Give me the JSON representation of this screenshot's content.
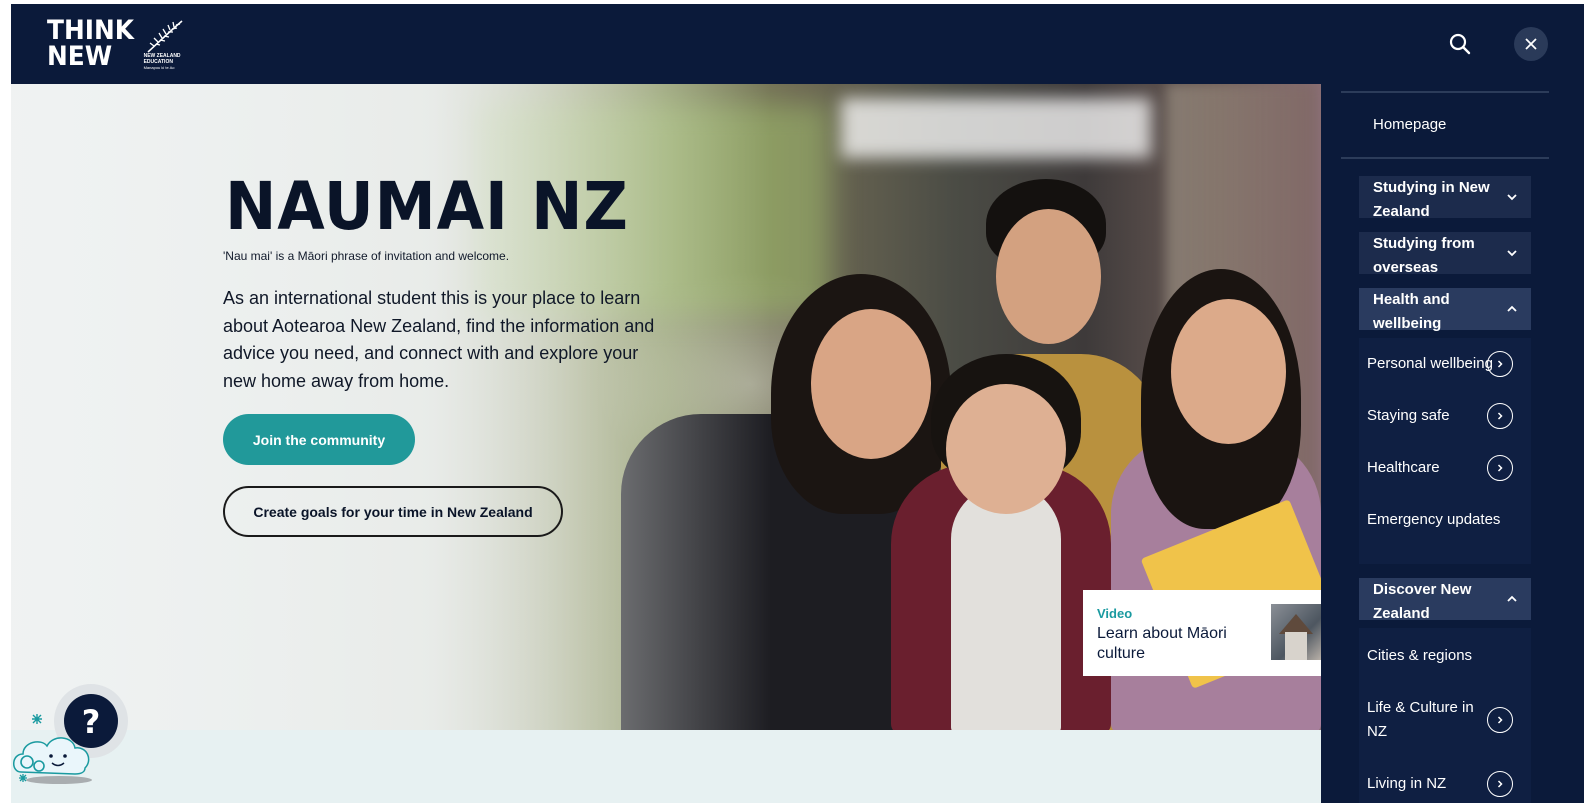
{
  "header": {
    "logo_line1": "THINK",
    "logo_line2": "NEW",
    "logo_sub1": "NEW ZEALAND",
    "logo_sub2": "EDUCATION",
    "logo_sub3": "Manapou ki te Ao"
  },
  "hero": {
    "title": "NAUMAI NZ",
    "subtitle": "'Nau mai' is a Māori phrase of invitation and welcome.",
    "lead": "As an international student this is your place to learn about Aotearoa New Zealand, find the information and advice you need, and connect with and explore your new home away from home.",
    "primary_button": "Join the community",
    "secondary_button": "Create goals for your time in New Zealand"
  },
  "video_card": {
    "label": "Video",
    "title": "Learn about Māori culture"
  },
  "help": {
    "glyph": "?"
  },
  "nav": {
    "home": "Homepage",
    "sections": [
      {
        "label": "Studying in New Zealand",
        "expanded": false
      },
      {
        "label": "Studying from overseas",
        "expanded": false
      },
      {
        "label": "Health and wellbeing",
        "expanded": true,
        "items": [
          "Personal wellbeing",
          "Staying safe",
          "Healthcare",
          "Emergency updates"
        ]
      },
      {
        "label": "Discover New Zealand",
        "expanded": true,
        "items": [
          "Cities & regions",
          "Life & Culture in NZ",
          "Living in NZ"
        ]
      }
    ]
  },
  "colors": {
    "navy": "#0b1a3a",
    "teal": "#21999a",
    "panel_section": "#1c2b4c",
    "band": "#e7f1f2"
  }
}
